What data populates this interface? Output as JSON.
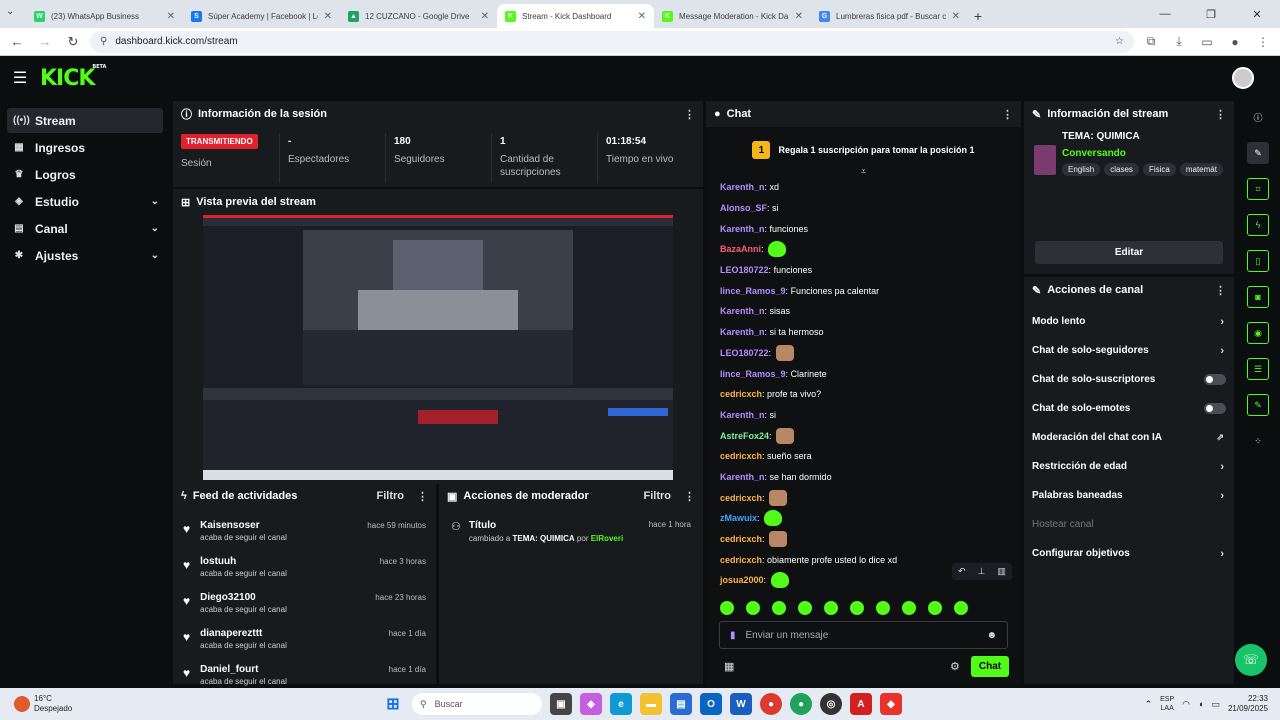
{
  "browser": {
    "tabs": [
      {
        "title": "(23) WhatsApp Business",
        "color": "#25d366",
        "glyph": "W"
      },
      {
        "title": "Súper Academy | Facebook | Lo",
        "color": "#1877f2",
        "glyph": "S"
      },
      {
        "title": "12 CUZCANO - Google Drive",
        "color": "#1ea362",
        "glyph": "▲"
      },
      {
        "title": "Stream - Kick Dashboard",
        "color": "#53fc18",
        "glyph": "K"
      },
      {
        "title": "Message Moderation - Kick Da",
        "color": "#53fc18",
        "glyph": "K"
      },
      {
        "title": "Lumbreras fisica pdf - Buscar co",
        "color": "#4285f4",
        "glyph": "G"
      }
    ],
    "url": "dashboard.kick.com/stream"
  },
  "topbar": {
    "logo": "KICK",
    "logo_sup": "BETA"
  },
  "sidebar": {
    "items": [
      {
        "label": "Stream",
        "icon": "stream-icon",
        "glyph": "((•))",
        "active": true
      },
      {
        "label": "Ingresos",
        "icon": "revenue-icon",
        "glyph": "▦"
      },
      {
        "label": "Logros",
        "icon": "trophy-icon",
        "glyph": "♛"
      },
      {
        "label": "Estudio",
        "icon": "studio-icon",
        "glyph": "◈",
        "chevron": true
      },
      {
        "label": "Canal",
        "icon": "channel-icon",
        "glyph": "▤",
        "chevron": true
      },
      {
        "label": "Ajustes",
        "icon": "settings-icon",
        "glyph": "✱",
        "chevron": true
      }
    ]
  },
  "session": {
    "title": "Información de la sesión",
    "live_badge": "TRANSMITIENDO",
    "session_label": "Sesión",
    "stats": [
      {
        "value": "-",
        "label": "Espectadores"
      },
      {
        "value": "180",
        "label": "Seguidores"
      },
      {
        "value": "1",
        "label": "Cantidad de suscripciones"
      },
      {
        "value": "01:18:54",
        "label": "Tiempo en vivo"
      }
    ]
  },
  "preview": {
    "title": "Vista previa del stream"
  },
  "feed": {
    "title": "Feed de actividades",
    "filter": "Filtro",
    "items": [
      {
        "name": "Kaisensoser",
        "action": "acaba de seguir el canal",
        "time": "hace 59 minutos"
      },
      {
        "name": "lostuuh",
        "action": "acaba de seguir el canal",
        "time": "hace 3 horas"
      },
      {
        "name": "Diego32100",
        "action": "acaba de seguir el canal",
        "time": "hace 23 horas"
      },
      {
        "name": "dianaperezttt",
        "action": "acaba de seguir el canal",
        "time": "hace 1 día"
      },
      {
        "name": "Daniel_fourt",
        "action": "acaba de seguir el canal",
        "time": "hace 1 día"
      }
    ]
  },
  "modactions": {
    "title": "Acciones de moderador",
    "filter": "Filtro",
    "item": {
      "title": "Título",
      "changed": "cambiado a",
      "value": "TEMA: QUIMICA",
      "by": "por",
      "user": "ElRoveri",
      "time": "hace 1 hora"
    }
  },
  "chat": {
    "title": "Chat",
    "gift_text": "Regala 1 suscripción para tomar la posición 1",
    "gift_number": "1",
    "messages": [
      {
        "user": "Karenth_n",
        "color": "#b48cff",
        "text": "xd"
      },
      {
        "user": "Alonso_SF",
        "color": "#b48cff",
        "text": "si"
      },
      {
        "user": "Karenth_n",
        "color": "#b48cff",
        "text": "funciones"
      },
      {
        "user": "BazaAnni",
        "color": "#ff5c7a",
        "text": "",
        "emote": "g"
      },
      {
        "user": "LEO180722",
        "color": "#b48cff",
        "text": "funciones"
      },
      {
        "user": "lince_Ramos_9",
        "color": "#b48cff",
        "text": "Funciones pa calentar"
      },
      {
        "user": "Karenth_n",
        "color": "#b48cff",
        "text": "sisas"
      },
      {
        "user": "Karenth_n",
        "color": "#b48cff",
        "text": "si ta hermoso"
      },
      {
        "user": "LEO180722",
        "color": "#b48cff",
        "text": "",
        "emote": "f"
      },
      {
        "user": "lince_Ramos_9",
        "color": "#b48cff",
        "text": "Clarinete"
      },
      {
        "user": "cedricxch",
        "color": "#ffb347",
        "text": "profe ta vivo?"
      },
      {
        "user": "Karenth_n",
        "color": "#b48cff",
        "text": "si"
      },
      {
        "user": "AstreFox24",
        "color": "#7cf2a8",
        "text": "",
        "emote": "f"
      },
      {
        "user": "cedricxch",
        "color": "#ffb347",
        "text": "sueño sera"
      },
      {
        "user": "Karenth_n",
        "color": "#b48cff",
        "text": "se han dormido"
      },
      {
        "user": "cedricxch",
        "color": "#ffb347",
        "text": "",
        "emote": "f"
      },
      {
        "user": "zMawuix",
        "color": "#3ea6ff",
        "text": "",
        "emote": "g"
      },
      {
        "user": "cedricxch",
        "color": "#ffb347",
        "text": "",
        "emote": "f"
      },
      {
        "user": "cedricxch",
        "color": "#ffb347",
        "text": "obiamente profe usted lo dice xd"
      },
      {
        "user": "josua2000",
        "color": "#ffb347",
        "text": "",
        "emote": "g"
      }
    ],
    "input_placeholder": "Enviar un mensaje",
    "send_label": "Chat"
  },
  "stream_info": {
    "title": "Información del stream",
    "topic": "TEMA: QUIMICA",
    "category": "Conversando",
    "tags": [
      "English",
      "clases",
      "Fisica",
      "matemát"
    ],
    "edit_label": "Editar"
  },
  "channel_actions": {
    "title": "Acciones de canal",
    "items": [
      {
        "label": "Modo lento",
        "type": "arrow"
      },
      {
        "label": "Chat de solo-seguidores",
        "type": "arrow"
      },
      {
        "label": "Chat de solo-suscriptores",
        "type": "toggle"
      },
      {
        "label": "Chat de solo-emotes",
        "type": "toggle"
      },
      {
        "label": "Moderación del chat con IA",
        "type": "external"
      },
      {
        "label": "Restricción de edad",
        "type": "arrow"
      },
      {
        "label": "Palabras baneadas",
        "type": "arrow"
      },
      {
        "label": "Hostear canal",
        "type": "disabled"
      },
      {
        "label": "Configurar objetivos",
        "type": "arrow"
      }
    ]
  },
  "taskbar": {
    "weather_temp": "16°C",
    "weather_desc": "Despejado",
    "search_placeholder": "Buscar",
    "lang": "ESP",
    "lang_sub": "LAA",
    "time": "22:33",
    "date": "21/09/2025"
  },
  "colors": {
    "accent": "#53fc18",
    "live": "#e0222e"
  }
}
